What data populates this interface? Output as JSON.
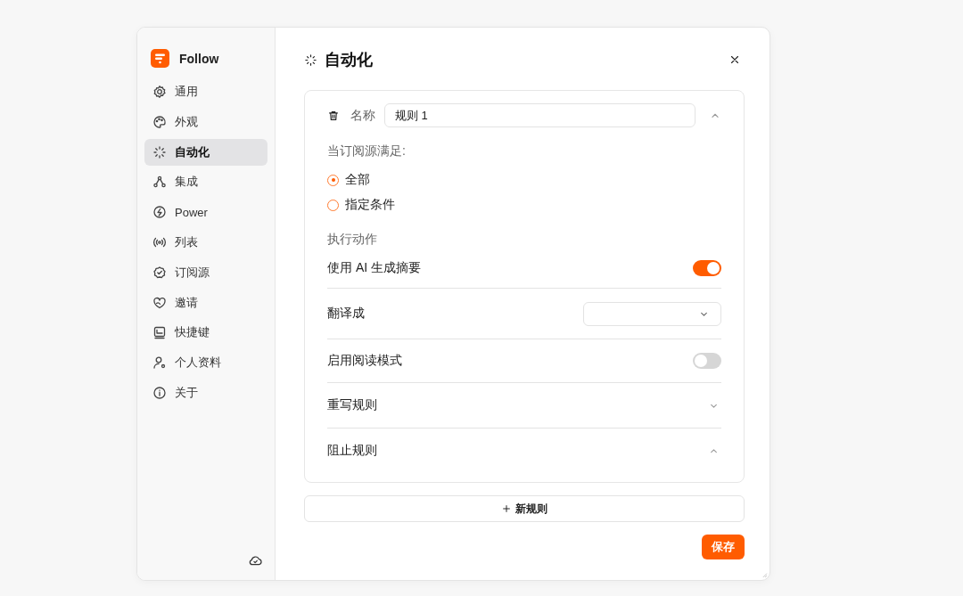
{
  "app": {
    "name": "Follow"
  },
  "sidebar": {
    "items": [
      {
        "label": "通用",
        "kind": "gear",
        "selected": false
      },
      {
        "label": "外观",
        "kind": "palette",
        "selected": false
      },
      {
        "label": "自动化",
        "kind": "sparkle",
        "selected": true
      },
      {
        "label": "集成",
        "kind": "nodes",
        "selected": false
      },
      {
        "label": "Power",
        "kind": "bolt",
        "selected": false
      },
      {
        "label": "列表",
        "kind": "broadcast",
        "selected": false
      },
      {
        "label": "订阅源",
        "kind": "badge",
        "selected": false
      },
      {
        "label": "邀请",
        "kind": "heart",
        "selected": false
      },
      {
        "label": "快捷键",
        "kind": "keyboard",
        "selected": false
      },
      {
        "label": "个人资料",
        "kind": "user",
        "selected": false
      },
      {
        "label": "关于",
        "kind": "info",
        "selected": false
      }
    ]
  },
  "page": {
    "title": "自动化"
  },
  "rule": {
    "name_label": "名称",
    "name_value": "规则 1",
    "expanded": true,
    "condition_label": "当订阅源满足:",
    "options": [
      {
        "label": "全部",
        "selected": true
      },
      {
        "label": "指定条件",
        "selected": false
      }
    ],
    "actions_label": "执行动作",
    "actions": [
      {
        "kind": "toggle",
        "label": "使用 AI 生成摘要",
        "on": true
      },
      {
        "kind": "select",
        "label": "翻译成"
      },
      {
        "kind": "toggle",
        "label": "启用阅读模式",
        "on": false
      },
      {
        "kind": "collapsible",
        "label": "重写规则",
        "expanded": false
      },
      {
        "kind": "collapsible",
        "label": "阻止规则",
        "expanded": true
      }
    ]
  },
  "add_button": {
    "label": "新规则"
  },
  "save_button": {
    "label": "保存"
  }
}
